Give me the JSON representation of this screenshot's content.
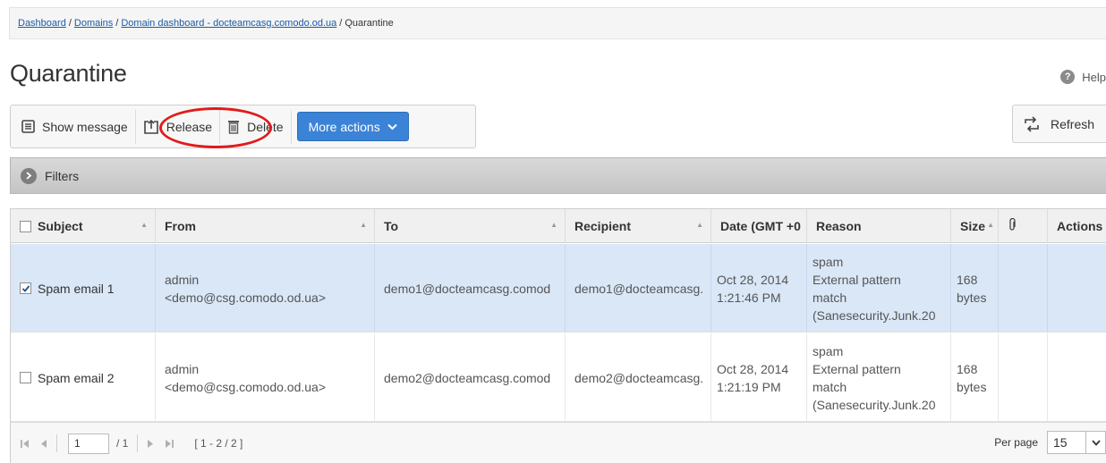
{
  "breadcrumb": {
    "items": [
      "Dashboard",
      "Domains",
      "Domain dashboard - docteamcasg.comodo.od.ua"
    ],
    "current": "Quarantine",
    "separator": "/"
  },
  "page": {
    "title": "Quarantine",
    "help_label": "Help"
  },
  "toolbar": {
    "show_message_label": "Show message",
    "release_label": "Release",
    "delete_label": "Delete",
    "more_actions_label": "More actions",
    "refresh_label": "Refresh"
  },
  "filters": {
    "label": "Filters"
  },
  "table": {
    "columns": [
      "Subject",
      "From",
      "To",
      "Recipient",
      "Date (GMT +0",
      "Reason",
      "Size",
      "",
      "Actions"
    ],
    "rows": [
      {
        "selected": true,
        "subject": "Spam email 1",
        "from_name": "admin",
        "from_email": "<demo@csg.comodo.od.ua>",
        "to": "demo1@docteamcasg.comod",
        "recipient": "demo1@docteamcasg.",
        "date": "Oct 28, 2014",
        "time": "1:21:46 PM",
        "reason_1": "spam",
        "reason_2": "External pattern",
        "reason_3": "match",
        "reason_4": "(Sanesecurity.Junk.20",
        "size_value": "168",
        "size_unit": "bytes"
      },
      {
        "selected": false,
        "subject": "Spam email 2",
        "from_name": "admin",
        "from_email": "<demo@csg.comodo.od.ua>",
        "to": "demo2@docteamcasg.comod",
        "recipient": "demo2@docteamcasg.",
        "date": "Oct 28, 2014",
        "time": "1:21:19 PM",
        "reason_1": "spam",
        "reason_2": "External pattern",
        "reason_3": "match",
        "reason_4": "(Sanesecurity.Junk.20",
        "size_value": "168",
        "size_unit": "bytes"
      }
    ]
  },
  "pager": {
    "page": "1",
    "total_pages": "/ 1",
    "range": "[ 1 - 2 / 2 ]",
    "per_page_label": "Per page",
    "per_page_value": "15"
  },
  "colors": {
    "accent": "#3b83d6",
    "highlight": "#e01b1b",
    "selected_row": "#d9e7f7"
  }
}
